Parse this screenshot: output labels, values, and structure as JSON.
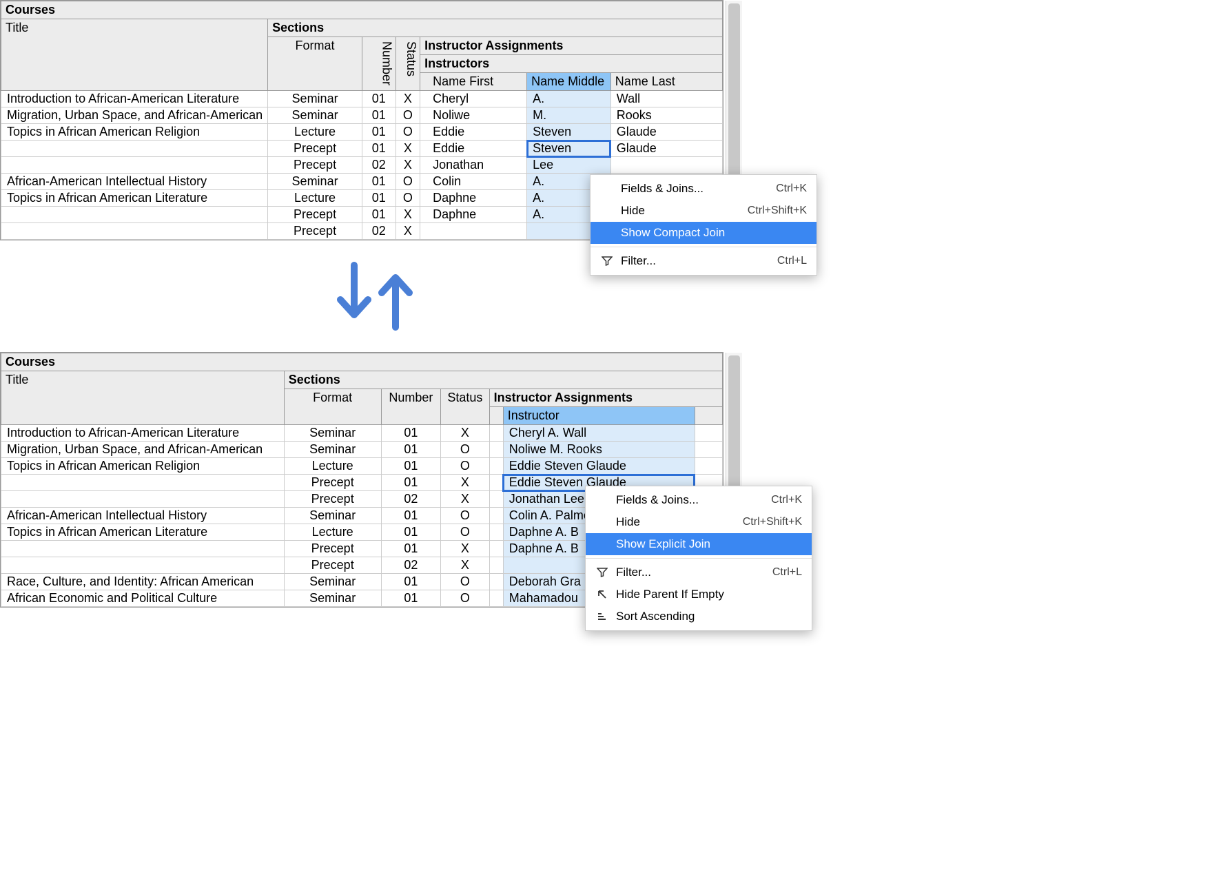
{
  "top": {
    "headers": {
      "courses": "Courses",
      "title": "Title",
      "sections": "Sections",
      "format": "Format",
      "number": "Number",
      "status": "Status",
      "instructor_assignments": "Instructor Assignments",
      "instructors": "Instructors",
      "name_first": "Name First",
      "name_middle": "Name Middle",
      "name_last": "Name Last"
    },
    "rows": [
      {
        "title": "Introduction to African-American Literature",
        "format": "Seminar",
        "number": "01",
        "status": "X",
        "first": "Cheryl",
        "middle": "A.",
        "last": "Wall"
      },
      {
        "title": "Migration, Urban Space, and African-American",
        "format": "Seminar",
        "number": "01",
        "status": "O",
        "first": "Noliwe",
        "middle": "M.",
        "last": "Rooks"
      },
      {
        "title": "Topics in African American Religion",
        "format": "Lecture",
        "number": "01",
        "status": "O",
        "first": "Eddie",
        "middle": "Steven",
        "last": "Glaude"
      },
      {
        "title": "",
        "format": "Precept",
        "number": "01",
        "status": "X",
        "first": "Eddie",
        "middle": "Steven",
        "last": "Glaude",
        "focus": true
      },
      {
        "title": "",
        "format": "Precept",
        "number": "02",
        "status": "X",
        "first": "Jonathan",
        "middle": "Lee",
        "last": ""
      },
      {
        "title": "African-American Intellectual History",
        "format": "Seminar",
        "number": "01",
        "status": "O",
        "first": "Colin",
        "middle": "A.",
        "last": ""
      },
      {
        "title": "Topics in African American Literature",
        "format": "Lecture",
        "number": "01",
        "status": "O",
        "first": "Daphne",
        "middle": "A.",
        "last": ""
      },
      {
        "title": "",
        "format": "Precept",
        "number": "01",
        "status": "X",
        "first": "Daphne",
        "middle": "A.",
        "last": ""
      },
      {
        "title": "",
        "format": "Precept",
        "number": "02",
        "status": "X",
        "first": "",
        "middle": "",
        "last": ""
      }
    ],
    "menu": {
      "fields_joins": "Fields & Joins...",
      "fields_joins_sc": "Ctrl+K",
      "hide": "Hide",
      "hide_sc": "Ctrl+Shift+K",
      "show_compact": "Show Compact Join",
      "filter": "Filter...",
      "filter_sc": "Ctrl+L"
    }
  },
  "bot": {
    "headers": {
      "courses": "Courses",
      "title": "Title",
      "sections": "Sections",
      "format": "Format",
      "number": "Number",
      "status": "Status",
      "instructor_assignments": "Instructor Assignments",
      "instructor": "Instructor"
    },
    "rows": [
      {
        "title": "Introduction to African-American Literature",
        "format": "Seminar",
        "number": "01",
        "status": "X",
        "instr": "Cheryl A. Wall"
      },
      {
        "title": "Migration, Urban Space, and African-American",
        "format": "Seminar",
        "number": "01",
        "status": "O",
        "instr": "Noliwe M. Rooks"
      },
      {
        "title": "Topics in African American Religion",
        "format": "Lecture",
        "number": "01",
        "status": "O",
        "instr": "Eddie Steven Glaude"
      },
      {
        "title": "",
        "format": "Precept",
        "number": "01",
        "status": "X",
        "instr": "Eddie Steven Glaude",
        "focus": true
      },
      {
        "title": "",
        "format": "Precept",
        "number": "02",
        "status": "X",
        "instr": "Jonathan Lee"
      },
      {
        "title": "African-American Intellectual History",
        "format": "Seminar",
        "number": "01",
        "status": "O",
        "instr": "Colin A. Palmer"
      },
      {
        "title": "Topics in African American Literature",
        "format": "Lecture",
        "number": "01",
        "status": "O",
        "instr": "Daphne A. B"
      },
      {
        "title": "",
        "format": "Precept",
        "number": "01",
        "status": "X",
        "instr": "Daphne A. B"
      },
      {
        "title": "",
        "format": "Precept",
        "number": "02",
        "status": "X",
        "instr": ""
      },
      {
        "title": "Race, Culture, and Identity: African American",
        "format": "Seminar",
        "number": "01",
        "status": "O",
        "instr": "Deborah Gra"
      },
      {
        "title": "African Economic and Political Culture",
        "format": "Seminar",
        "number": "01",
        "status": "O",
        "instr": "Mahamadou"
      }
    ],
    "menu": {
      "fields_joins": "Fields & Joins...",
      "fields_joins_sc": "Ctrl+K",
      "hide": "Hide",
      "hide_sc": "Ctrl+Shift+K",
      "show_explicit": "Show Explicit Join",
      "filter": "Filter...",
      "filter_sc": "Ctrl+L",
      "hide_parent": "Hide Parent If Empty",
      "sort_asc": "Sort Ascending"
    }
  }
}
